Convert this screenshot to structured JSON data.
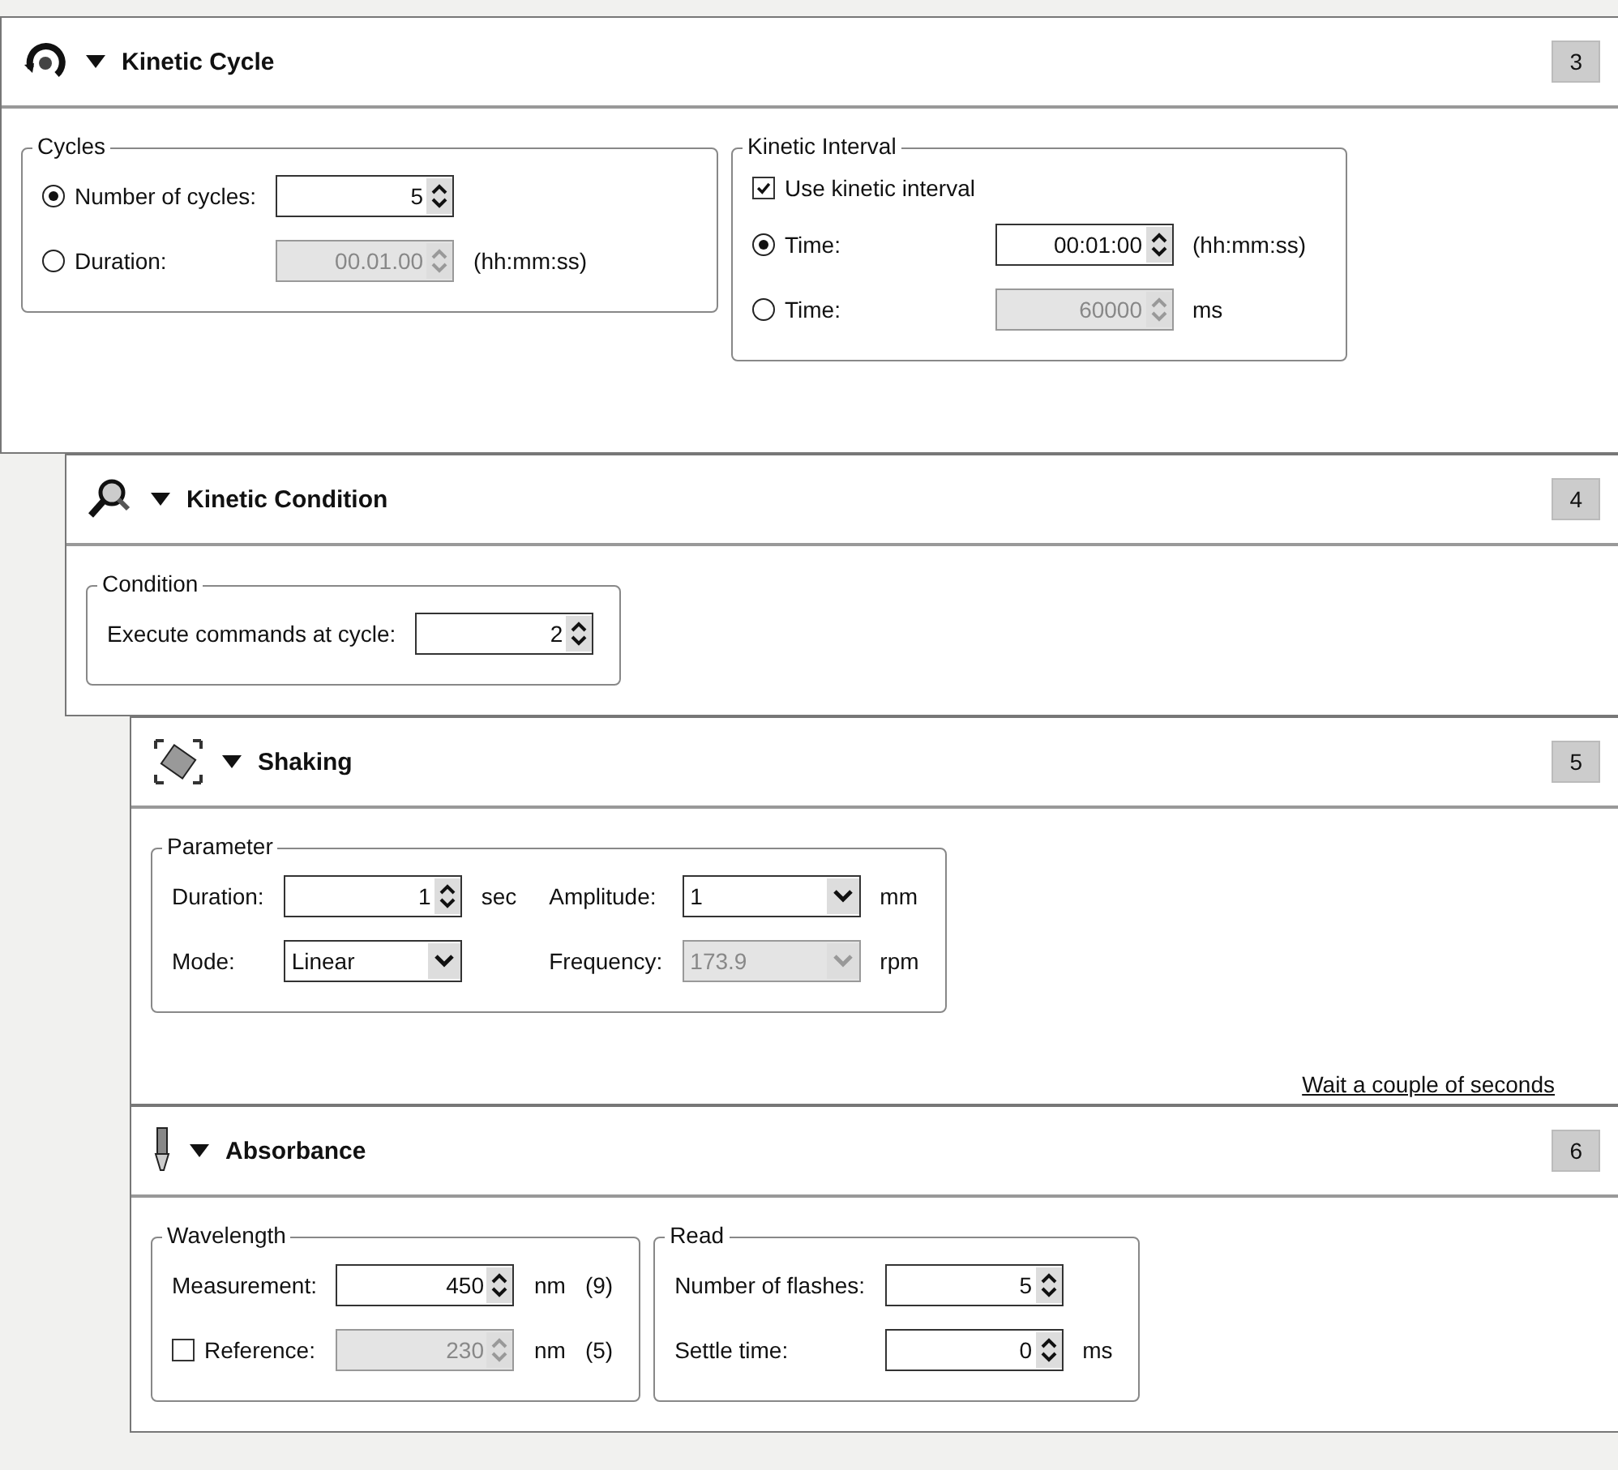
{
  "panels": [
    {
      "kind": "cycle",
      "title": "Kinetic Cycle",
      "number": "3",
      "expanded": true,
      "groups": [
        {
          "title": "Cycles",
          "columns": [
            {
              "rows": [
                {
                  "items": [
                    {
                      "kind": "radio",
                      "label": "Number of cycles:",
                      "selected": true
                    },
                    {
                      "kind": "spin",
                      "value": "5",
                      "disabled": false
                    }
                  ]
                },
                {
                  "items": [
                    {
                      "kind": "radio",
                      "label": "Duration:",
                      "selected": false
                    },
                    {
                      "kind": "spin",
                      "value": "00.01.00",
                      "disabled": true
                    },
                    {
                      "kind": "unit",
                      "text": "(hh:mm:ss)"
                    }
                  ]
                }
              ]
            }
          ]
        },
        {
          "title": "Kinetic Interval",
          "columns": [
            {
              "rows": [
                {
                  "items": [
                    {
                      "kind": "checkbox",
                      "label": "Use kinetic interval",
                      "checked": true
                    }
                  ]
                },
                {
                  "items": [
                    {
                      "kind": "radio",
                      "label": "Time:",
                      "selected": true
                    },
                    {
                      "kind": "spin",
                      "value": "00:01:00",
                      "disabled": false
                    },
                    {
                      "kind": "unit",
                      "text": "(hh:mm:ss)"
                    }
                  ]
                },
                {
                  "items": [
                    {
                      "kind": "radio",
                      "label": "Time:",
                      "selected": false
                    },
                    {
                      "kind": "spin",
                      "value": "60000",
                      "disabled": true
                    },
                    {
                      "kind": "unit",
                      "text": "ms"
                    }
                  ]
                }
              ]
            }
          ]
        }
      ],
      "children": [
        {
          "kind": "condition",
          "title": "Kinetic Condition",
          "number": "4",
          "expanded": true,
          "groups": [
            {
              "title": "Condition",
              "columns": [
                {
                  "rows": [
                    {
                      "items": [
                        {
                          "kind": "label",
                          "text": "Execute commands at cycle:"
                        },
                        {
                          "kind": "spin",
                          "value": "2",
                          "disabled": false
                        }
                      ]
                    }
                  ]
                }
              ]
            }
          ],
          "children": [
            {
              "kind": "shaking",
              "title": "Shaking",
              "number": "5",
              "expanded": true,
              "link": "Wait a couple of seconds",
              "groups": [
                {
                  "title": "Parameter",
                  "columns": [
                    {
                      "rows": [
                        {
                          "items": [
                            {
                              "kind": "label",
                              "text": "Duration:"
                            },
                            {
                              "kind": "spin",
                              "value": "1",
                              "disabled": false
                            },
                            {
                              "kind": "unit",
                              "text": "sec"
                            }
                          ]
                        },
                        {
                          "items": [
                            {
                              "kind": "label",
                              "text": "Mode:"
                            },
                            {
                              "kind": "combo",
                              "value": "Linear",
                              "disabled": false
                            }
                          ]
                        }
                      ]
                    },
                    {
                      "rows": [
                        {
                          "items": [
                            {
                              "kind": "label",
                              "text": "Amplitude:"
                            },
                            {
                              "kind": "combo",
                              "value": "1",
                              "disabled": false
                            },
                            {
                              "kind": "unit",
                              "text": "mm"
                            }
                          ]
                        },
                        {
                          "items": [
                            {
                              "kind": "label",
                              "text": "Frequency:"
                            },
                            {
                              "kind": "combo",
                              "value": "173.9",
                              "disabled": true
                            },
                            {
                              "kind": "unit",
                              "text": "rpm"
                            }
                          ]
                        }
                      ]
                    }
                  ]
                }
              ]
            },
            {
              "kind": "absorbance",
              "title": "Absorbance",
              "number": "6",
              "expanded": true,
              "groups": [
                {
                  "title": "Wavelength",
                  "columns": [
                    {
                      "rows": [
                        {
                          "items": [
                            {
                              "kind": "label",
                              "text": "Measurement:"
                            },
                            {
                              "kind": "spin",
                              "value": "450",
                              "disabled": false
                            },
                            {
                              "kind": "unit",
                              "text": "nm"
                            },
                            {
                              "kind": "unit",
                              "text": "(9)"
                            }
                          ]
                        },
                        {
                          "items": [
                            {
                              "kind": "checkbox",
                              "label": "Reference:",
                              "checked": false
                            },
                            {
                              "kind": "spin",
                              "value": "230",
                              "disabled": true
                            },
                            {
                              "kind": "unit",
                              "text": "nm"
                            },
                            {
                              "kind": "unit",
                              "text": "(5)"
                            }
                          ]
                        }
                      ]
                    }
                  ]
                },
                {
                  "title": "Read",
                  "columns": [
                    {
                      "rows": [
                        {
                          "items": [
                            {
                              "kind": "label",
                              "text": "Number of flashes:"
                            },
                            {
                              "kind": "spin",
                              "value": "5",
                              "disabled": false
                            }
                          ]
                        },
                        {
                          "items": [
                            {
                              "kind": "label",
                              "text": "Settle time:"
                            },
                            {
                              "kind": "spin",
                              "value": "0",
                              "disabled": false
                            },
                            {
                              "kind": "unit",
                              "text": "ms"
                            }
                          ]
                        }
                      ]
                    }
                  ]
                }
              ]
            }
          ]
        }
      ]
    }
  ]
}
